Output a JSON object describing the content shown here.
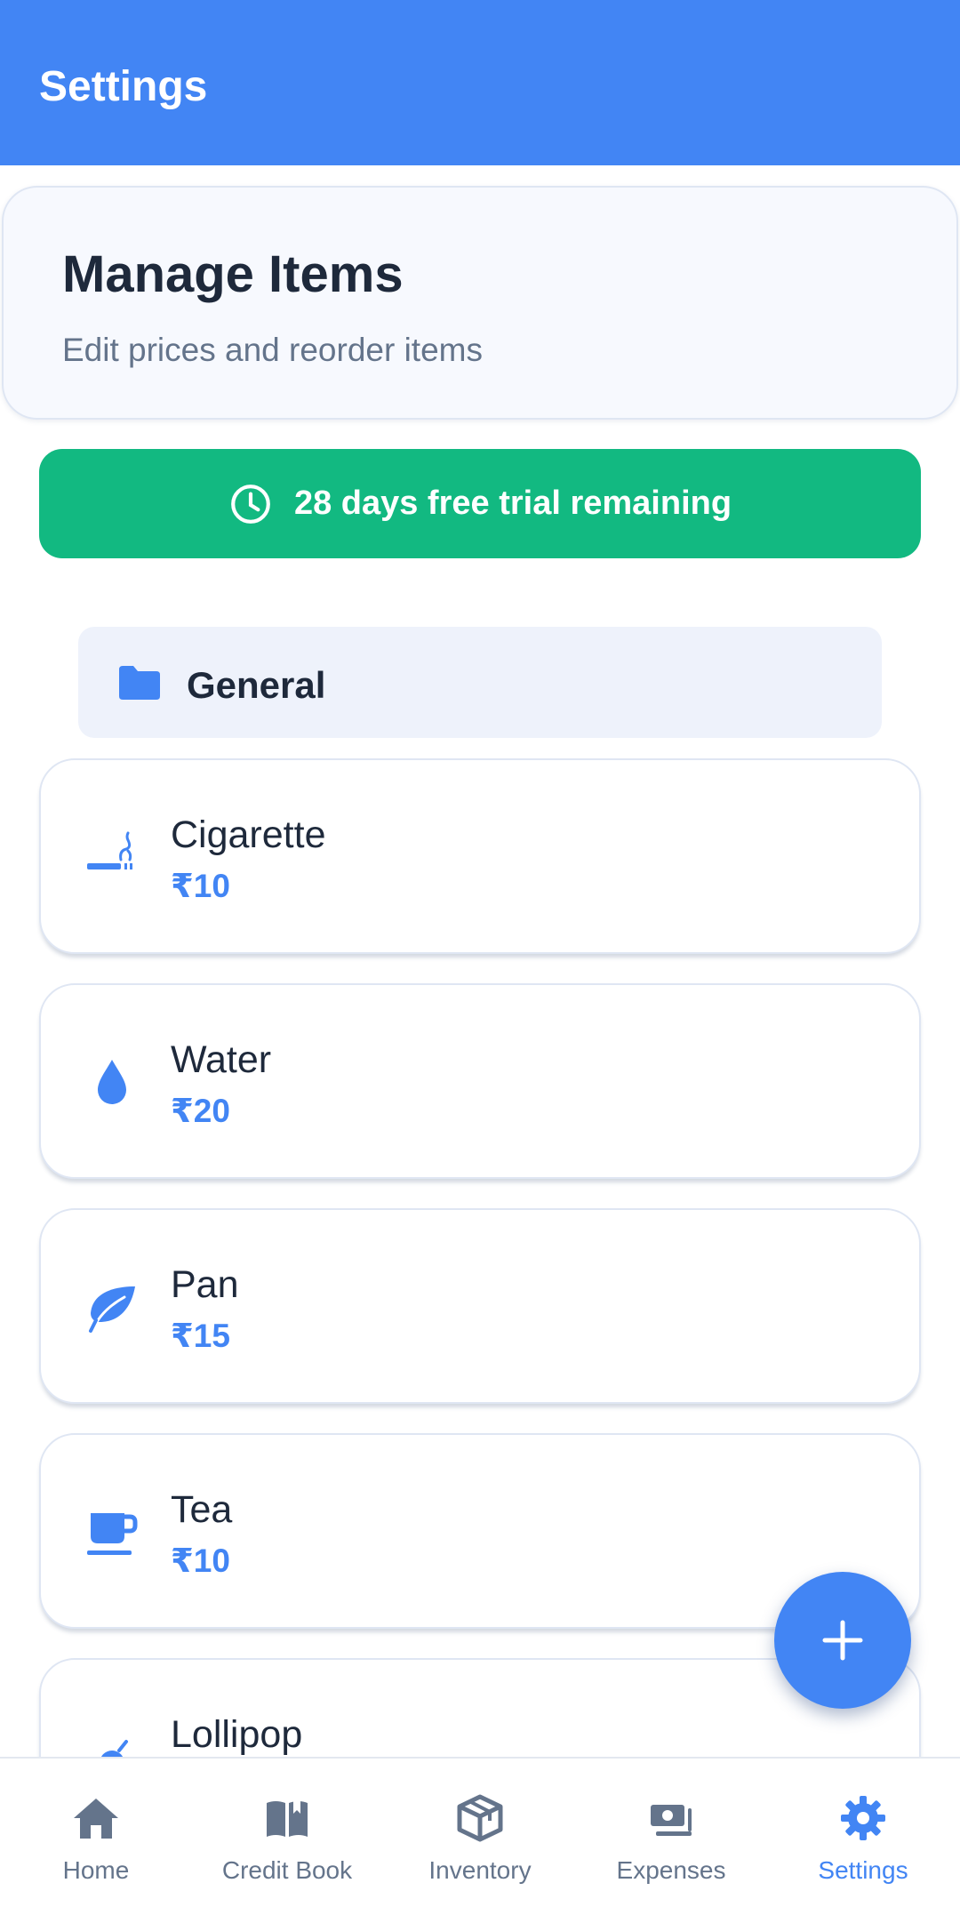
{
  "appbar": {
    "title": "Settings"
  },
  "manage": {
    "title": "Manage Items",
    "subtitle": "Edit prices and reorder items"
  },
  "trial": {
    "text": "28 days free trial remaining",
    "icon": "clock-icon"
  },
  "category": {
    "label": "General",
    "icon": "folder-icon"
  },
  "items": [
    {
      "name": "Cigarette",
      "price": "₹10",
      "icon": "smoking-icon"
    },
    {
      "name": "Water",
      "price": "₹20",
      "icon": "water-drop-icon"
    },
    {
      "name": "Pan",
      "price": "₹15",
      "icon": "leaf-icon"
    },
    {
      "name": "Tea",
      "price": "₹10",
      "icon": "cup-icon"
    },
    {
      "name": "Lollipop",
      "price": "",
      "icon": "candy-icon"
    }
  ],
  "fab": {
    "icon": "plus-icon"
  },
  "nav": [
    {
      "label": "Home",
      "icon": "home-icon",
      "active": false
    },
    {
      "label": "Credit Book",
      "icon": "book-icon",
      "active": false
    },
    {
      "label": "Inventory",
      "icon": "box-icon",
      "active": false
    },
    {
      "label": "Expenses",
      "icon": "money-icon",
      "active": false
    },
    {
      "label": "Settings",
      "icon": "gear-icon",
      "active": true
    }
  ],
  "colors": {
    "primary": "#4285f4",
    "trial": "#12b981",
    "text": "#1e293b",
    "muted": "#64748b"
  }
}
